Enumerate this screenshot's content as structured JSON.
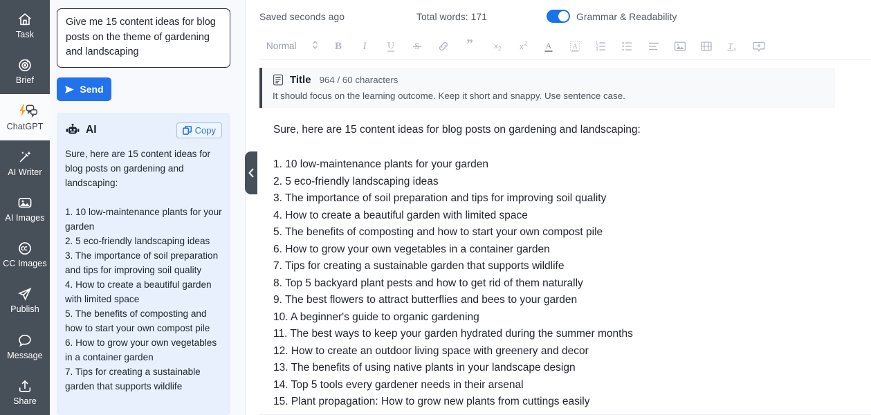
{
  "sidebar": {
    "items": [
      {
        "label": "Task",
        "icon": "home-icon",
        "active": false
      },
      {
        "label": "Brief",
        "icon": "target-icon",
        "active": false
      },
      {
        "label": "ChatGPT",
        "icon": "chatgpt-icon",
        "active": true
      },
      {
        "label": "AI Writer",
        "icon": "magic-wand-icon",
        "active": false
      },
      {
        "label": "AI Images",
        "icon": "image-ai-icon",
        "active": false
      },
      {
        "label": "CC Images",
        "icon": "creative-commons-icon",
        "active": false
      },
      {
        "label": "Publish",
        "icon": "paper-plane-icon",
        "active": false
      },
      {
        "label": "Message",
        "icon": "chat-bubble-icon",
        "active": false
      },
      {
        "label": "Share",
        "icon": "share-upload-icon",
        "active": false
      }
    ]
  },
  "chat": {
    "prompt_value": "Give me 15 content ideas for blog posts on the theme of gardening and landscaping",
    "prompt_placeholder": "Give me 15 content ideas for blog posts on the theme of gardening and landscaping",
    "send_label": "Send",
    "send_icon": "send-arrow-icon",
    "ai_label": "AI",
    "ai_icon": "robot-icon",
    "copy_label": "Copy",
    "copy_icon": "copy-icon",
    "response_intro": "Sure, here are 15 content ideas for blog posts on gardening and landscaping:",
    "response_items": [
      "1. 10 low-maintenance plants for your garden",
      "2. 5 eco-friendly landscaping ideas",
      "3. The importance of soil preparation and tips for improving soil quality",
      "4. How to create a beautiful garden with limited space",
      "5. The benefits of composting and how to start your own compost pile",
      "6. How to grow your own vegetables in a container garden",
      "7. Tips for creating a sustainable garden that supports wildlife"
    ]
  },
  "collapse_handle": {
    "icon": "chevron-left-icon"
  },
  "editor": {
    "header": {
      "saved_status": "Saved seconds ago",
      "total_words": "Total words: 171",
      "grammar_toggle_label": "Grammar & Readability",
      "grammar_toggle_on": true,
      "toggle_color": "#1a73e8"
    },
    "toolbar": {
      "style_select": "Normal",
      "style_select_icon": "chevron-updown-icon",
      "buttons": [
        {
          "name": "bold-button",
          "glyph": "B"
        },
        {
          "name": "italic-button",
          "glyph": "I"
        },
        {
          "name": "underline-button",
          "glyph": "U"
        },
        {
          "name": "strikethrough-button",
          "glyph": "S"
        },
        {
          "name": "link-button",
          "glyph": "🔗"
        },
        {
          "name": "blockquote-button",
          "glyph": "”"
        },
        {
          "name": "subscript-button",
          "glyph": "x₂"
        },
        {
          "name": "superscript-button",
          "glyph": "x²"
        },
        {
          "name": "text-color-button",
          "glyph": "A"
        },
        {
          "name": "highlight-color-button",
          "glyph": "A"
        },
        {
          "name": "ordered-list-button",
          "glyph": "1."
        },
        {
          "name": "bullet-list-button",
          "glyph": "•"
        },
        {
          "name": "align-button",
          "glyph": "≡"
        },
        {
          "name": "insert-image-button",
          "glyph": "🖼"
        },
        {
          "name": "insert-video-button",
          "glyph": "🎞"
        },
        {
          "name": "clear-formatting-button",
          "glyph": "Tx"
        },
        {
          "name": "add-comment-button",
          "glyph": "＋"
        }
      ]
    },
    "title_banner": {
      "icon": "document-icon",
      "label": "Title",
      "char_count": "964 / 60 characters",
      "hint": "It should focus on the learning outcome. Keep it short and snappy. Use sentence case."
    },
    "document": {
      "intro": "Sure, here are 15 content ideas for blog posts on gardening and landscaping:",
      "items": [
        "1. 10 low-maintenance plants for your garden",
        "2. 5 eco-friendly landscaping ideas",
        "3. The importance of soil preparation and tips for improving soil quality",
        "4. How to create a beautiful garden with limited space",
        "5. The benefits of composting and how to start your own compost pile",
        "6. How to grow your own vegetables in a container garden",
        "7. Tips for creating a sustainable garden that supports wildlife",
        "8. Top 5 backyard plant pests and how to get rid of them naturally",
        "9. The best flowers to attract butterflies and bees to your garden",
        "10. A beginner's guide to organic gardening",
        "11. The best ways to keep your garden hydrated during the summer months",
        "12. How to create an outdoor living space with greenery and decor",
        "13. The benefits of using native plants in your landscape design",
        "14. Top 5 tools every gardener needs in their arsenal",
        "15. Plant propagation: How to grow new plants from cuttings easily"
      ]
    }
  },
  "colors": {
    "rail_bg": "#474f59",
    "accent_blue": "#2272eb",
    "ai_card_bg": "#e8f0fd",
    "chat_bg": "#f7f9fc",
    "banner_bg": "#f7f9fb"
  }
}
